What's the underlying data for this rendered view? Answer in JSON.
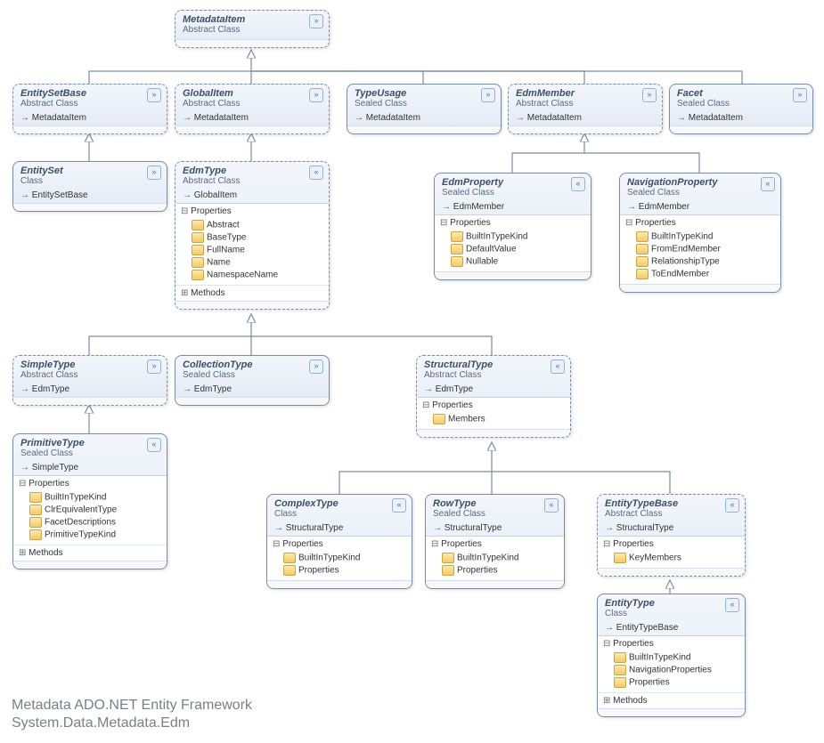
{
  "chart_data": {
    "type": "inheritance-diagram",
    "title": "Metadata ADO.NET Entity Framework",
    "namespace": "System.Data.Metadata.Edm",
    "nodes": [
      {
        "name": "MetadataItem",
        "kind": "Abstract Class",
        "inherits": null
      },
      {
        "name": "EntitySetBase",
        "kind": "Abstract Class",
        "inherits": "MetadataItem"
      },
      {
        "name": "GlobalItem",
        "kind": "Abstract Class",
        "inherits": "MetadataItem"
      },
      {
        "name": "TypeUsage",
        "kind": "Sealed Class",
        "inherits": "MetadataItem"
      },
      {
        "name": "EdmMember",
        "kind": "Abstract Class",
        "inherits": "MetadataItem"
      },
      {
        "name": "Facet",
        "kind": "Sealed Class",
        "inherits": "MetadataItem"
      },
      {
        "name": "EntitySet",
        "kind": "Class",
        "inherits": "EntitySetBase"
      },
      {
        "name": "EdmType",
        "kind": "Abstract Class",
        "inherits": "GlobalItem",
        "properties": [
          "Abstract",
          "BaseType",
          "FullName",
          "Name",
          "NamespaceName"
        ],
        "methods": true
      },
      {
        "name": "EdmProperty",
        "kind": "Sealed Class",
        "inherits": "EdmMember",
        "properties": [
          "BuiltInTypeKind",
          "DefaultValue",
          "Nullable"
        ]
      },
      {
        "name": "NavigationProperty",
        "kind": "Sealed Class",
        "inherits": "EdmMember",
        "properties": [
          "BuiltInTypeKind",
          "FromEndMember",
          "RelationshipType",
          "ToEndMember"
        ]
      },
      {
        "name": "SimpleType",
        "kind": "Abstract Class",
        "inherits": "EdmType"
      },
      {
        "name": "CollectionType",
        "kind": "Sealed Class",
        "inherits": "EdmType"
      },
      {
        "name": "StructuralType",
        "kind": "Abstract Class",
        "inherits": "EdmType",
        "properties": [
          "Members"
        ]
      },
      {
        "name": "PrimitiveType",
        "kind": "Sealed Class",
        "inherits": "SimpleType",
        "properties": [
          "BuiltInTypeKind",
          "ClrEquivalentType",
          "FacetDescriptions",
          "PrimitiveTypeKind"
        ],
        "methods": true
      },
      {
        "name": "ComplexType",
        "kind": "Class",
        "inherits": "StructuralType",
        "properties": [
          "BuiltInTypeKind",
          "Properties"
        ]
      },
      {
        "name": "RowType",
        "kind": "Sealed Class",
        "inherits": "StructuralType",
        "properties": [
          "BuiltInTypeKind",
          "Properties"
        ]
      },
      {
        "name": "EntityTypeBase",
        "kind": "Abstract Class",
        "inherits": "StructuralType",
        "properties": [
          "KeyMembers"
        ]
      },
      {
        "name": "EntityType",
        "kind": "Class",
        "inherits": "EntityTypeBase",
        "properties": [
          "BuiltInTypeKind",
          "NavigationProperties",
          "Properties"
        ],
        "methods": true
      }
    ]
  },
  "footer": {
    "line1": "Metadata ADO.NET Entity Framework",
    "line2": "System.Data.Metadata.Edm"
  },
  "lbl": {
    "props": "Properties",
    "methods": "Methods"
  },
  "icon": {
    "collapse": "«",
    "expand": "»"
  },
  "c": {
    "metadataitem": {
      "t": "MetadataItem",
      "k": "Abstract Class"
    },
    "entitysetbase": {
      "t": "EntitySetBase",
      "k": "Abstract Class",
      "b": "MetadataItem"
    },
    "globalitem": {
      "t": "GlobalItem",
      "k": "Abstract Class",
      "b": "MetadataItem"
    },
    "typeusage": {
      "t": "TypeUsage",
      "k": "Sealed Class",
      "b": "MetadataItem"
    },
    "edmmember": {
      "t": "EdmMember",
      "k": "Abstract Class",
      "b": "MetadataItem"
    },
    "facet": {
      "t": "Facet",
      "k": "Sealed Class",
      "b": "MetadataItem"
    },
    "entityset": {
      "t": "EntitySet",
      "k": "Class",
      "b": "EntitySetBase"
    },
    "edmtype": {
      "t": "EdmType",
      "k": "Abstract Class",
      "b": "GlobalItem",
      "p": [
        "Abstract",
        "BaseType",
        "FullName",
        "Name",
        "NamespaceName"
      ]
    },
    "edmproperty": {
      "t": "EdmProperty",
      "k": "Sealed Class",
      "b": "EdmMember",
      "p": [
        "BuiltInTypeKind",
        "DefaultValue",
        "Nullable"
      ]
    },
    "navigationproperty": {
      "t": "NavigationProperty",
      "k": "Sealed Class",
      "b": "EdmMember",
      "p": [
        "BuiltInTypeKind",
        "FromEndMember",
        "RelationshipType",
        "ToEndMember"
      ]
    },
    "simpletype": {
      "t": "SimpleType",
      "k": "Abstract Class",
      "b": "EdmType"
    },
    "collectiontype": {
      "t": "CollectionType",
      "k": "Sealed Class",
      "b": "EdmType"
    },
    "structuraltype": {
      "t": "StructuralType",
      "k": "Abstract Class",
      "b": "EdmType",
      "p": [
        "Members"
      ]
    },
    "primitivetype": {
      "t": "PrimitiveType",
      "k": "Sealed Class",
      "b": "SimpleType",
      "p": [
        "BuiltInTypeKind",
        "ClrEquivalentType",
        "FacetDescriptions",
        "PrimitiveTypeKind"
      ]
    },
    "complextype": {
      "t": "ComplexType",
      "k": "Class",
      "b": "StructuralType",
      "p": [
        "BuiltInTypeKind",
        "Properties"
      ]
    },
    "rowtype": {
      "t": "RowType",
      "k": "Sealed Class",
      "b": "StructuralType",
      "p": [
        "BuiltInTypeKind",
        "Properties"
      ]
    },
    "entitytypebase": {
      "t": "EntityTypeBase",
      "k": "Abstract Class",
      "b": "StructuralType",
      "p": [
        "KeyMembers"
      ]
    },
    "entitytype": {
      "t": "EntityType",
      "k": "Class",
      "b": "EntityTypeBase",
      "p": [
        "BuiltInTypeKind",
        "NavigationProperties",
        "Properties"
      ]
    }
  }
}
